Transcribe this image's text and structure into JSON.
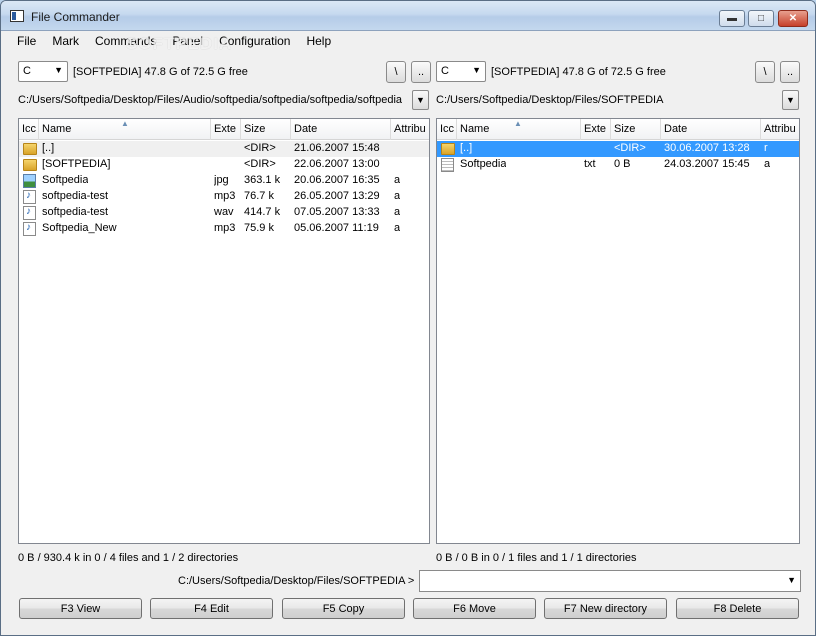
{
  "window": {
    "title": "File Commander",
    "watermark": "SOFTPEDIA"
  },
  "menu": [
    "File",
    "Mark",
    "Commands",
    "Panel",
    "Configuration",
    "Help"
  ],
  "left": {
    "drive": "C",
    "free": "[SOFTPEDIA]  47.8 G of 72.5 G free",
    "root_btn": "\\",
    "up_btn": "..",
    "path": "C:/Users/Softpedia/Desktop/Files/Audio/softpedia/softpedia/softpedia/softpedia",
    "columns": [
      "Icc",
      "Name",
      "Exte",
      "Size",
      "Date",
      "Attribu"
    ],
    "rows": [
      {
        "icon": "folder-icon",
        "name": "[..]",
        "ext": "",
        "size": "<DIR>",
        "date": "21.06.2007 15:48",
        "attr": ""
      },
      {
        "icon": "folder-icon",
        "name": "[SOFTPEDIA]",
        "ext": "",
        "size": "<DIR>",
        "date": "22.06.2007 13:00",
        "attr": ""
      },
      {
        "icon": "image-icon",
        "name": "Softpedia",
        "ext": "jpg",
        "size": "363.1 k",
        "date": "20.06.2007 16:35",
        "attr": "a"
      },
      {
        "icon": "music-icon",
        "name": "softpedia-test",
        "ext": "mp3",
        "size": "76.7 k",
        "date": "26.05.2007 13:29",
        "attr": "a"
      },
      {
        "icon": "music-icon",
        "name": "softpedia-test",
        "ext": "wav",
        "size": "414.7 k",
        "date": "07.05.2007 13:33",
        "attr": "a"
      },
      {
        "icon": "music-icon",
        "name": "Softpedia_New",
        "ext": "mp3",
        "size": "75.9 k",
        "date": "05.06.2007 11:19",
        "attr": "a"
      }
    ],
    "status": "0 B / 930.4 k in 0 / 4 files and 1 / 2 directories"
  },
  "right": {
    "drive": "C",
    "free": "[SOFTPEDIA]  47.8 G of 72.5 G free",
    "root_btn": "\\",
    "up_btn": "..",
    "path": "C:/Users/Softpedia/Desktop/Files/SOFTPEDIA",
    "columns": [
      "Icc",
      "Name",
      "Exte",
      "Size",
      "Date",
      "Attribu"
    ],
    "rows": [
      {
        "icon": "folder-icon",
        "name": "[..]",
        "ext": "",
        "size": "<DIR>",
        "date": "30.06.2007 13:28",
        "attr": "r"
      },
      {
        "icon": "doc-icon",
        "name": "Softpedia",
        "ext": "txt",
        "size": "0 B",
        "date": "24.03.2007 15:45",
        "attr": "a"
      }
    ],
    "status": "0 B / 0 B in 0 / 1 files and 1 / 1 directories"
  },
  "command_prompt": "C:/Users/Softpedia/Desktop/Files/SOFTPEDIA  >",
  "function_keys": [
    "F3 View",
    "F4 Edit",
    "F5 Copy",
    "F6 Move",
    "F7 New directory",
    "F8 Delete"
  ]
}
